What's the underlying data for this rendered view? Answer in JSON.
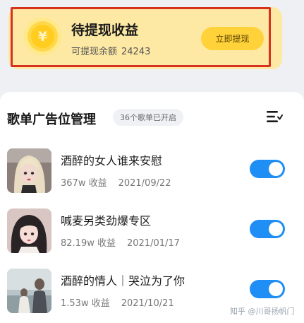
{
  "earnings": {
    "title": "待提现收益",
    "balance_label": "可提现余额",
    "balance_value": "24243",
    "withdraw_button": "立即提现",
    "coin_symbol": "¥"
  },
  "playlist_section": {
    "title": "歌单广告位管理",
    "count_badge": "36个歌单已开启",
    "sort_icon": "sort-list-icon",
    "items": [
      {
        "title": "酒醉的女人谁来安慰",
        "earnings": "367w 收益",
        "date": "2021/09/22",
        "enabled": true
      },
      {
        "title": "喊麦另类劲爆专区",
        "earnings": "82.19w 收益",
        "date": "2021/01/17",
        "enabled": true
      },
      {
        "title": "酒醉的情人｜哭泣为了你",
        "earnings": "1.53w 收益",
        "date": "2021/10/21",
        "enabled": true
      }
    ]
  },
  "watermark": "知乎 @川哥扬帆门",
  "colors": {
    "accent_blue": "#1f8ef5",
    "card_yellow": "#fde9a4",
    "button_yellow": "#ffd23a",
    "highlight_red": "#d7301f"
  }
}
